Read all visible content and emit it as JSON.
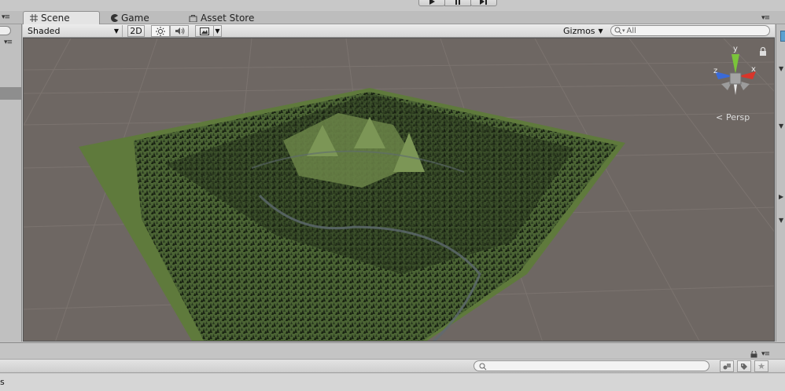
{
  "tabs": [
    {
      "label": "Scene",
      "icon": "hash-grid-icon"
    },
    {
      "label": "Game",
      "icon": "pacman-icon"
    },
    {
      "label": "Asset Store",
      "icon": "shopping-bag-icon"
    }
  ],
  "toolbar": {
    "shading_mode": "Shaded",
    "mode_2d_label": "2D",
    "gizmos_label": "Gizmos",
    "search_placeholder": "All"
  },
  "scene_view": {
    "projection_label": "Persp",
    "gizmo_axes": {
      "y": "y",
      "x": "x",
      "z": "z"
    }
  },
  "status": {
    "left_text": "s"
  },
  "colors": {
    "accent_x": "#d8352a",
    "accent_y": "#7ac43a",
    "accent_z": "#3a6ad8",
    "viewport_bg": "#6e6763",
    "terrain_green": "#5f7a3c"
  }
}
